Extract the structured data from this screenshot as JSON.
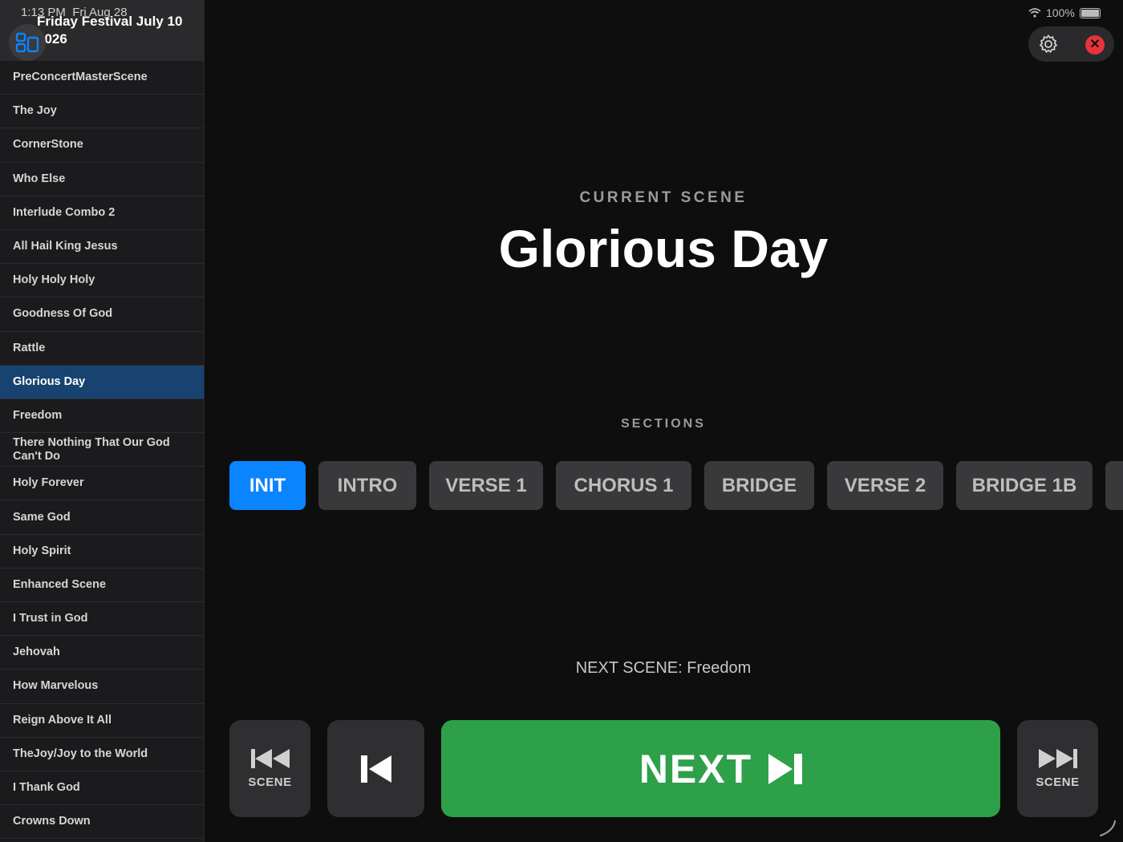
{
  "status_bar": {
    "time": "1:13 PM",
    "date": "Fri Aug 28",
    "battery": "100%"
  },
  "sidebar": {
    "playlist_title": "Friday Festival July 10 2026",
    "items": [
      {
        "label": "PreConcertMasterScene"
      },
      {
        "label": "The Joy"
      },
      {
        "label": "CornerStone"
      },
      {
        "label": "Who Else"
      },
      {
        "label": "Interlude Combo 2"
      },
      {
        "label": "All Hail King Jesus"
      },
      {
        "label": "Holy Holy Holy"
      },
      {
        "label": "Goodness Of God"
      },
      {
        "label": "Rattle"
      },
      {
        "label": "Glorious Day",
        "active": true
      },
      {
        "label": "Freedom"
      },
      {
        "label": "There Nothing That Our God Can't Do"
      },
      {
        "label": "Holy Forever"
      },
      {
        "label": "Same God"
      },
      {
        "label": "Holy Spirit"
      },
      {
        "label": "Enhanced Scene"
      },
      {
        "label": "I Trust in God"
      },
      {
        "label": "Jehovah"
      },
      {
        "label": "How Marvelous"
      },
      {
        "label": "Reign Above It All"
      },
      {
        "label": "TheJoy/Joy to  the  World"
      },
      {
        "label": "I Thank God"
      },
      {
        "label": "Crowns Down"
      }
    ]
  },
  "main": {
    "current_label": "CURRENT SCENE",
    "current_scene": "Glorious Day",
    "sections_label": "SECTIONS",
    "sections": [
      {
        "label": "INIT",
        "active": true
      },
      {
        "label": "INTRO"
      },
      {
        "label": "VERSE 1"
      },
      {
        "label": "CHORUS 1"
      },
      {
        "label": "BRIDGE"
      },
      {
        "label": "VERSE 2"
      },
      {
        "label": "BRIDGE 1B"
      },
      {
        "label": ""
      }
    ],
    "next_scene": "NEXT SCENE: Freedom"
  },
  "controls": {
    "prev_scene_label": "SCENE",
    "next_label": "NEXT",
    "next_scene_label": "SCENE"
  },
  "colors": {
    "accent": "#0a84ff",
    "selected_row": "#184370",
    "next_button": "#2ea04a",
    "close": "#e8323c"
  },
  "icons": [
    "layout-icon",
    "gear-icon",
    "close-icon",
    "skip-back-icon",
    "previous-icon",
    "next-icon",
    "skip-forward-icon",
    "wifi-icon",
    "battery-icon",
    "spinner-icon"
  ]
}
